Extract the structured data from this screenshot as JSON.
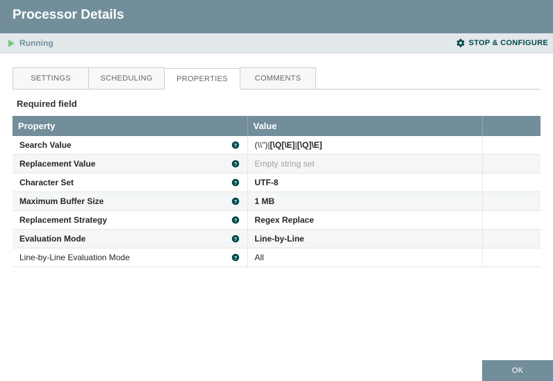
{
  "header": {
    "title": "Processor Details"
  },
  "status": {
    "state": "Running",
    "stop_label": "STOP & CONFIGURE"
  },
  "tabs": [
    {
      "label": "SETTINGS",
      "active": false
    },
    {
      "label": "SCHEDULING",
      "active": false
    },
    {
      "label": "PROPERTIES",
      "active": true
    },
    {
      "label": "COMMENTS",
      "active": false
    }
  ],
  "section_title": "Required field",
  "table": {
    "headers": {
      "property": "Property",
      "value": "Value"
    },
    "rows": [
      {
        "property": "Search Value",
        "bold_prop": true,
        "value_composite": {
          "a": "(\\\\\")|",
          "b": "[\\Q[\\E]",
          "c": "|",
          "d": "[\\Q]\\E]"
        }
      },
      {
        "property": "Replacement Value",
        "bold_prop": true,
        "value": "Empty string set",
        "placeholder": true
      },
      {
        "property": "Character Set",
        "bold_prop": true,
        "value": "UTF-8",
        "bold_val": true
      },
      {
        "property": "Maximum Buffer Size",
        "bold_prop": true,
        "value": "1 MB",
        "bold_val": true
      },
      {
        "property": "Replacement Strategy",
        "bold_prop": true,
        "value": "Regex Replace",
        "bold_val": true
      },
      {
        "property": "Evaluation Mode",
        "bold_prop": true,
        "value": "Line-by-Line",
        "bold_val": true
      },
      {
        "property": "Line-by-Line Evaluation Mode",
        "bold_prop": false,
        "value": "All",
        "bold_val": false
      }
    ]
  },
  "footer": {
    "ok_label": "OK"
  }
}
